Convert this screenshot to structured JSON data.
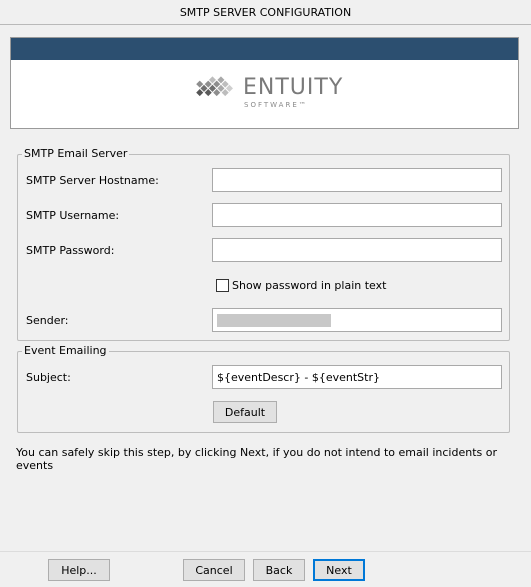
{
  "window": {
    "title": "SMTP SERVER CONFIGURATION"
  },
  "banner": {
    "brand_name": "ENTUITY",
    "brand_sub": "SOFTWARE™",
    "colors": {
      "strip": "#2c4f70",
      "logo_gray": "#7a7a7a"
    }
  },
  "smtp_group": {
    "legend": "SMTP Email Server",
    "hostname": {
      "label": "SMTP Server Hostname:",
      "value": ""
    },
    "username": {
      "label": "SMTP Username:",
      "value": ""
    },
    "password": {
      "label": "SMTP Password:",
      "value": ""
    },
    "show_password": {
      "label": "Show password in plain text",
      "checked": false
    },
    "sender": {
      "label": "Sender:",
      "value_redacted": true
    }
  },
  "event_group": {
    "legend": "Event Emailing",
    "subject": {
      "label": "Subject:",
      "value": "${eventDescr} - ${eventStr}"
    },
    "default_button": "Default"
  },
  "info_text": "You can safely skip this step, by clicking Next, if you do not intend to email incidents or events",
  "footer": {
    "help": "Help...",
    "cancel": "Cancel",
    "back": "Back",
    "next": "Next"
  }
}
